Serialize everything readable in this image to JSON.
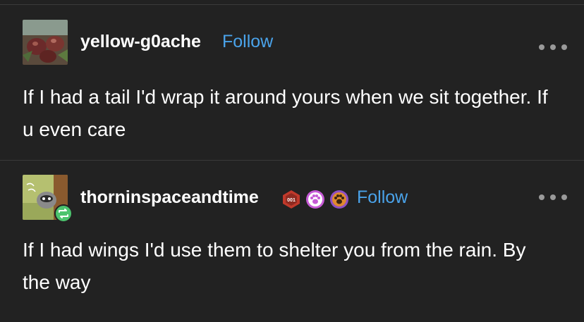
{
  "posts": [
    {
      "username": "yellow-g0ache",
      "follow_label": "Follow",
      "body": "If I had a tail I'd wrap it around yours when we sit together. If u even care"
    },
    {
      "username": "thorninspaceandtime",
      "follow_label": "Follow",
      "badges": [
        {
          "name": "red-hexagon-badge",
          "color": "#c0392b",
          "text": "001"
        },
        {
          "name": "paw-badge-pink",
          "color": "#c65ad6"
        },
        {
          "name": "paw-badge-orange",
          "color": "#8e4fc4"
        }
      ],
      "body": "If I had wings I'd use them to shelter you from the rain. By the way"
    }
  ],
  "colors": {
    "background": "#222222",
    "divider": "#3a3a3a",
    "follow": "#4aa3ea",
    "text": "#ffffff",
    "more_dots": "#9a9a9a",
    "reblog_green": "#4cc46e"
  }
}
